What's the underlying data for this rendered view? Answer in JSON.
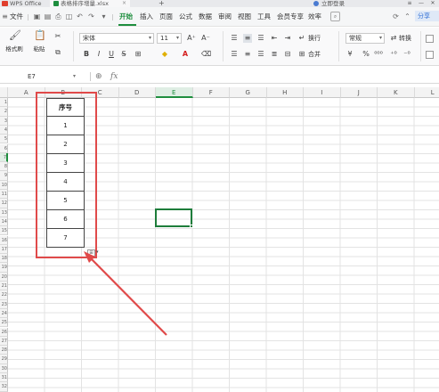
{
  "titlebar": {
    "app_tab": "WPS Office",
    "file_tab": "表格排序增量.xlsx",
    "close_glyph": "×",
    "add_glyph": "+",
    "account": "立即登录",
    "win_menu": "≡",
    "win_min": "—",
    "win_close": "✕"
  },
  "menu": {
    "file": "文件",
    "items": [
      "开始",
      "插入",
      "页面",
      "公式",
      "数据",
      "审阅",
      "视图",
      "工具",
      "会员专享",
      "效率"
    ],
    "share": "分享"
  },
  "ribbon": {
    "format_painter": "格式刷",
    "paste": "粘贴",
    "cut_glyph": "✂",
    "font_name": "宋体",
    "font_size": "11",
    "font_grow": "A⁺",
    "font_shrink": "A⁻",
    "bold": "B",
    "italic": "I",
    "underline": "U",
    "wrap": "换行",
    "merge": "合并",
    "number_format": "常规",
    "convert": "转换",
    "currency": "¥",
    "percent": "%",
    "thousands": "⁰⁰⁰",
    "dropdown_glyph": "▾"
  },
  "formula_bar": {
    "cell_ref": "E7",
    "zoom_glyph": "⊕",
    "fx": "fx",
    "formula": ""
  },
  "columns": [
    "A",
    "B",
    "C",
    "D",
    "E",
    "F",
    "G",
    "H",
    "I",
    "J",
    "K",
    "L"
  ],
  "selected_column": "E",
  "rows": [
    "1",
    "2",
    "3",
    "4",
    "5",
    "6",
    "7",
    "8",
    "9",
    "10",
    "11",
    "12",
    "13",
    "14",
    "15",
    "16",
    "17",
    "18",
    "19",
    "20",
    "21",
    "22",
    "23",
    "24",
    "25",
    "26",
    "27",
    "28",
    "29",
    "30",
    "31",
    "32"
  ],
  "selected_row": "7",
  "table": {
    "header": "序号",
    "values": [
      "1",
      "2",
      "3",
      "4",
      "5",
      "6",
      "7"
    ]
  },
  "colors": {
    "accent": "#1e8e3e",
    "annotation": "#e04a4a",
    "selection": "#1e7d3b"
  }
}
